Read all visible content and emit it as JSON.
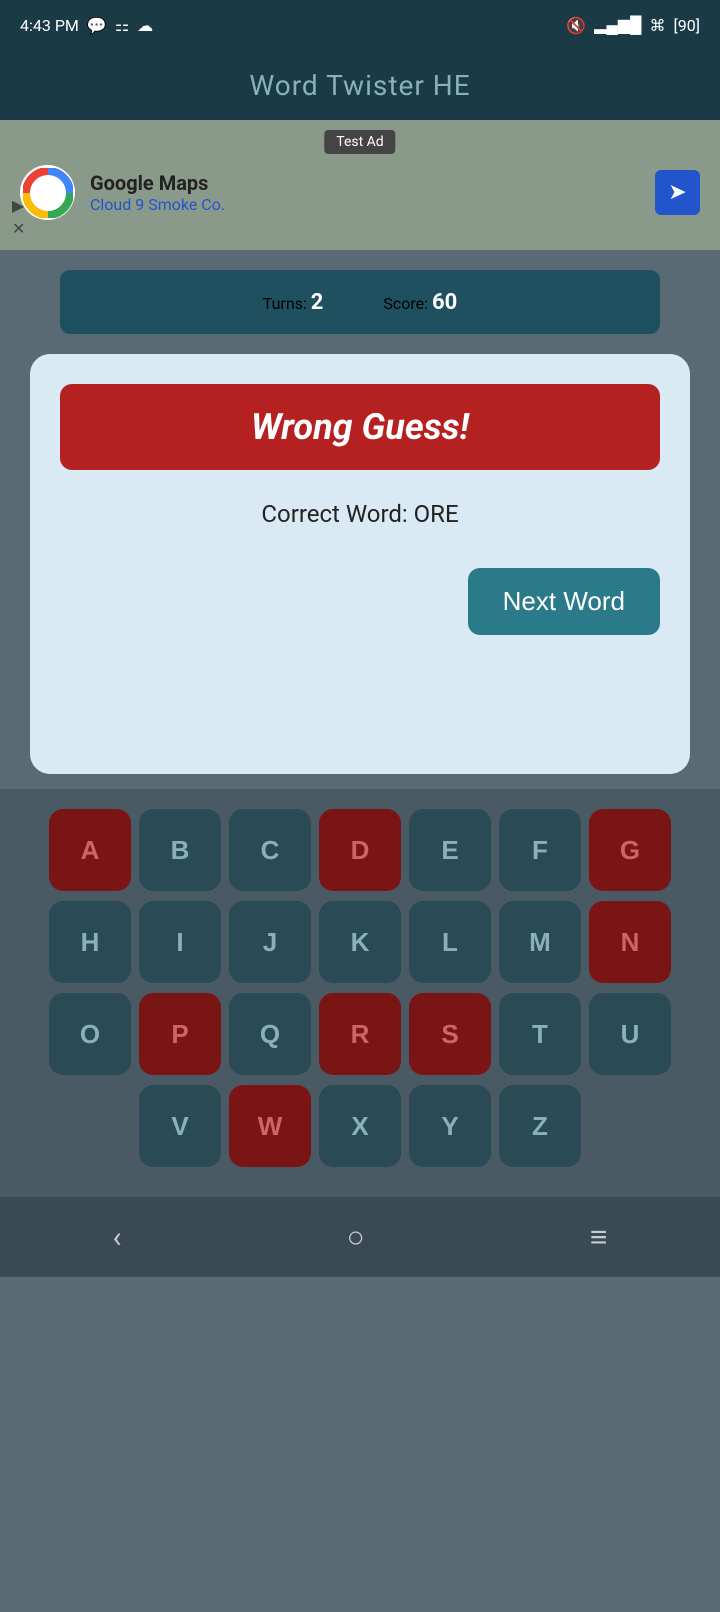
{
  "statusBar": {
    "time": "4:43 PM",
    "battery": "90"
  },
  "header": {
    "title": "Word Twister HE"
  },
  "ad": {
    "label": "Test Ad",
    "name": "Google Maps",
    "subtitle": "Cloud 9 Smoke Co."
  },
  "scoreBar": {
    "turnsLabel": "Turns:",
    "turnsValue": "2",
    "scoreLabel": "Score:",
    "scoreValue": "60"
  },
  "dialog": {
    "wrongGuessText": "Wrong Guess!",
    "correctWordLabel": "Correct Word: ORE",
    "nextWordButton": "Next Word"
  },
  "keyboard": {
    "rows": [
      [
        "A",
        "B",
        "C",
        "D",
        "E",
        "F",
        "G"
      ],
      [
        "H",
        "I",
        "J",
        "K",
        "L",
        "M",
        "N"
      ],
      [
        "O",
        "P",
        "Q",
        "R",
        "S",
        "T",
        "U"
      ],
      [
        "V",
        "W",
        "X",
        "Y",
        "Z"
      ]
    ],
    "usedKeys": [
      "D",
      "G",
      "N",
      "P",
      "R",
      "S",
      "W"
    ]
  },
  "navBar": {
    "backLabel": "‹",
    "homeLabel": "○",
    "menuLabel": "≡"
  }
}
